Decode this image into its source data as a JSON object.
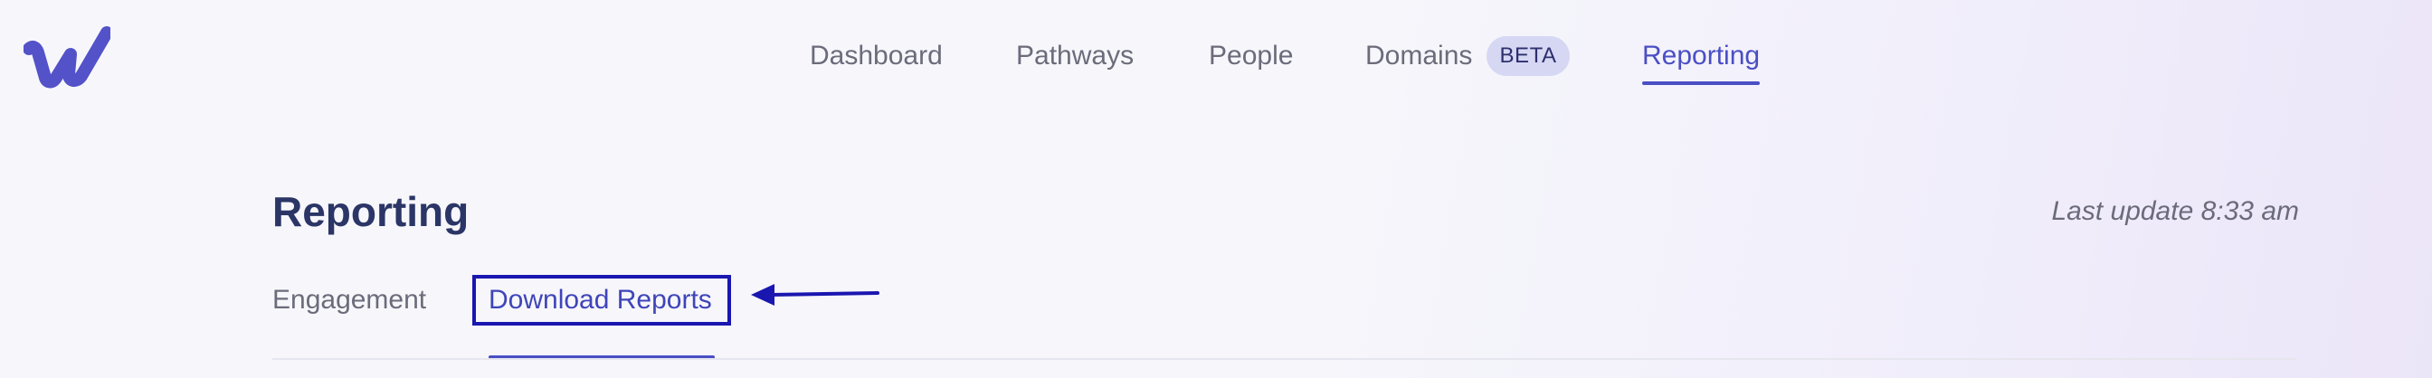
{
  "nav": {
    "items": [
      {
        "label": "Dashboard",
        "active": false
      },
      {
        "label": "Pathways",
        "active": false
      },
      {
        "label": "People",
        "active": false
      },
      {
        "label": "Domains",
        "active": false,
        "badge": "BETA"
      },
      {
        "label": "Reporting",
        "active": true
      }
    ]
  },
  "page": {
    "title": "Reporting",
    "last_update": "Last update 8:33 am"
  },
  "tabs": [
    {
      "label": "Engagement",
      "active": false
    },
    {
      "label": "Download Reports",
      "active": true
    }
  ],
  "colors": {
    "accent": "#4a4fc4",
    "highlight_box": "#1a16b0",
    "title": "#2b3566",
    "muted_text": "#6b6b7b",
    "badge_bg": "#d6d7f3"
  },
  "icons": {
    "logo": "w-logo-icon",
    "annotation": "arrow-left-icon"
  }
}
